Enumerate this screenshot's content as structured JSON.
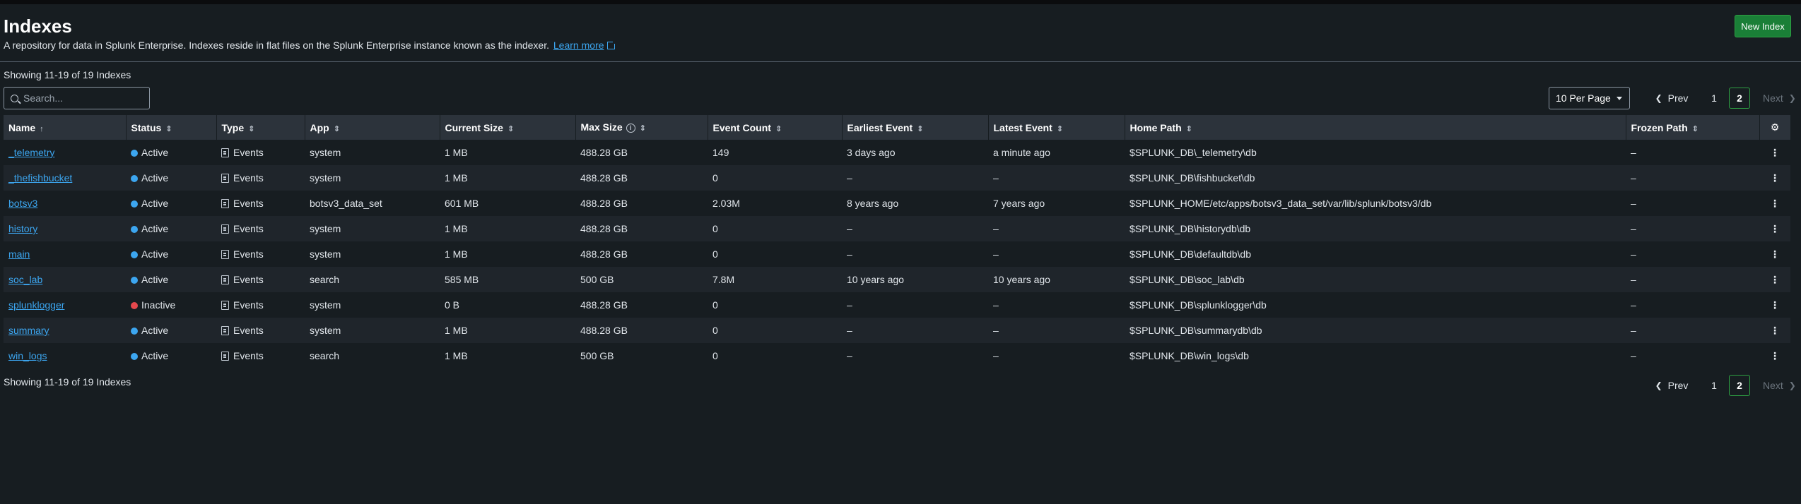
{
  "page": {
    "title": "Indexes",
    "description": "A repository for data in Splunk Enterprise. Indexes reside in flat files on the Splunk Enterprise instance known as the indexer.",
    "learn_more": "Learn more",
    "new_index_label": "New Index"
  },
  "summary": {
    "showing_top": "Showing 11-19 of 19 Indexes",
    "showing_bottom": "Showing 11-19 of 19 Indexes"
  },
  "search": {
    "placeholder": "Search..."
  },
  "per_page": {
    "selected": "10 Per Page"
  },
  "pagination": {
    "prev": "Prev",
    "next": "Next",
    "pages": [
      "1",
      "2"
    ],
    "current": "2"
  },
  "table": {
    "columns": [
      "Name",
      "Status",
      "Type",
      "App",
      "Current Size",
      "Max Size",
      "Event Count",
      "Earliest Event",
      "Latest Event",
      "Home Path",
      "Frozen Path"
    ],
    "rows": [
      {
        "name": "_telemetry",
        "status": "Active",
        "type": "Events",
        "app": "system",
        "current_size": "1 MB",
        "max_size": "488.28 GB",
        "event_count": "149",
        "earliest": "3 days ago",
        "latest": "a minute ago",
        "home_path": "$SPLUNK_DB\\_telemetry\\db",
        "frozen_path": "–"
      },
      {
        "name": "_thefishbucket",
        "status": "Active",
        "type": "Events",
        "app": "system",
        "current_size": "1 MB",
        "max_size": "488.28 GB",
        "event_count": "0",
        "earliest": "–",
        "latest": "–",
        "home_path": "$SPLUNK_DB\\fishbucket\\db",
        "frozen_path": "–"
      },
      {
        "name": "botsv3",
        "status": "Active",
        "type": "Events",
        "app": "botsv3_data_set",
        "current_size": "601 MB",
        "max_size": "488.28 GB",
        "event_count": "2.03M",
        "earliest": "8 years ago",
        "latest": "7 years ago",
        "home_path": "$SPLUNK_HOME/etc/apps/botsv3_data_set/var/lib/splunk/botsv3/db",
        "frozen_path": "–"
      },
      {
        "name": "history",
        "status": "Active",
        "type": "Events",
        "app": "system",
        "current_size": "1 MB",
        "max_size": "488.28 GB",
        "event_count": "0",
        "earliest": "–",
        "latest": "–",
        "home_path": "$SPLUNK_DB\\historydb\\db",
        "frozen_path": "–"
      },
      {
        "name": "main",
        "status": "Active",
        "type": "Events",
        "app": "system",
        "current_size": "1 MB",
        "max_size": "488.28 GB",
        "event_count": "0",
        "earliest": "–",
        "latest": "–",
        "home_path": "$SPLUNK_DB\\defaultdb\\db",
        "frozen_path": "–"
      },
      {
        "name": "soc_lab",
        "status": "Active",
        "type": "Events",
        "app": "search",
        "current_size": "585 MB",
        "max_size": "500 GB",
        "event_count": "7.8M",
        "earliest": "10 years ago",
        "latest": "10 years ago",
        "home_path": "$SPLUNK_DB\\soc_lab\\db",
        "frozen_path": "–"
      },
      {
        "name": "splunklogger",
        "status": "Inactive",
        "type": "Events",
        "app": "system",
        "current_size": "0 B",
        "max_size": "488.28 GB",
        "event_count": "0",
        "earliest": "–",
        "latest": "–",
        "home_path": "$SPLUNK_DB\\splunklogger\\db",
        "frozen_path": "–"
      },
      {
        "name": "summary",
        "status": "Active",
        "type": "Events",
        "app": "system",
        "current_size": "1 MB",
        "max_size": "488.28 GB",
        "event_count": "0",
        "earliest": "–",
        "latest": "–",
        "home_path": "$SPLUNK_DB\\summarydb\\db",
        "frozen_path": "–"
      },
      {
        "name": "win_logs",
        "status": "Active",
        "type": "Events",
        "app": "search",
        "current_size": "1 MB",
        "max_size": "500 GB",
        "event_count": "0",
        "earliest": "–",
        "latest": "–",
        "home_path": "$SPLUNK_DB\\win_logs\\db",
        "frozen_path": "–"
      }
    ]
  },
  "icons": {
    "sort": "sort-arrows-icon",
    "sort_asc": "sort-ascending-icon",
    "gear": "gear-icon",
    "kebab": "kebab-menu-icon",
    "type": "document-icon",
    "info": "info-icon",
    "external": "external-link-icon"
  },
  "colors": {
    "background": "#171d21",
    "header_row": "#2c333b",
    "link": "#3ca6f0",
    "active": "#3ca6f0",
    "inactive": "#e5484d",
    "primary_button": "#1a7f37"
  }
}
